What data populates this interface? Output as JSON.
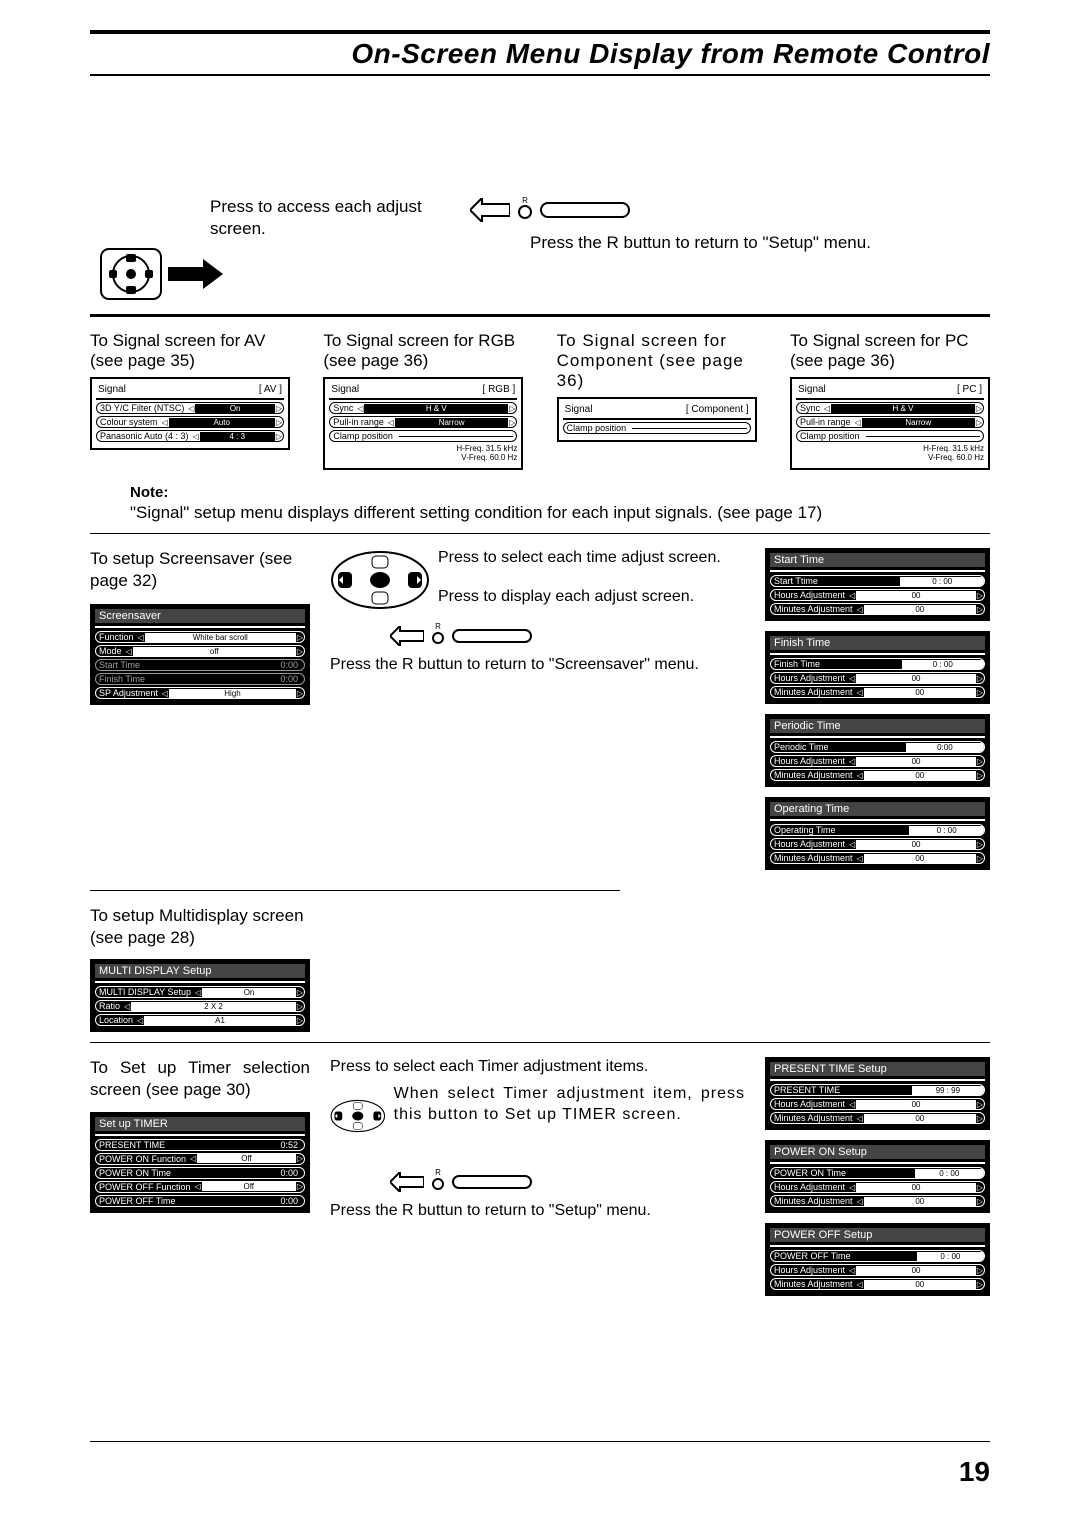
{
  "page_title": "On-Screen Menu Display from Remote Control",
  "page_number": "19",
  "intro": {
    "left_instr": "Press to access each adjust screen.",
    "right_instr": "Press the R buttun to return to \"Setup\" menu.",
    "r_label": "R"
  },
  "signals": {
    "av": {
      "heading": "To Signal screen for AV  (see page 35)",
      "title": "Signal",
      "tag": "[ AV ]",
      "rows": [
        {
          "label": "3D Y/C Filter (NTSC)",
          "val": "On"
        },
        {
          "label": "Colour system",
          "val": "Auto"
        },
        {
          "label": "Panasonic Auto (4 : 3)",
          "val": "4 : 3"
        }
      ]
    },
    "rgb": {
      "heading": "To Signal screen for RGB  (see page 36)",
      "title": "Signal",
      "tag": "[ RGB ]",
      "rows": [
        {
          "label": "Sync",
          "val": "H & V"
        },
        {
          "label": "Pull-in range",
          "val": "Narrow"
        },
        {
          "label": "Clamp position",
          "val": ""
        }
      ],
      "freq": [
        "H-Freq.  31.5  kHz",
        "V-Freq.  60.0  Hz"
      ]
    },
    "component": {
      "heading": "To Signal screen for Component (see page 36)",
      "title": "Signal",
      "tag": "[ Component ]",
      "rows": [
        {
          "label": "Clamp position",
          "val": ""
        }
      ]
    },
    "pc": {
      "heading": "To Signal screen for PC  (see page 36)",
      "title": "Signal",
      "tag": "[ PC ]",
      "rows": [
        {
          "label": "Sync",
          "val": "H & V"
        },
        {
          "label": "Pull-in range",
          "val": "Narrow"
        },
        {
          "label": "Clamp position",
          "val": ""
        }
      ],
      "freq": [
        "H-Freq.  31.5  kHz",
        "V-Freq.  60.0  Hz"
      ]
    }
  },
  "note": {
    "label": "Note:",
    "body": "\"Signal\" setup menu displays different setting condition for each input signals. (see page 17)"
  },
  "screensaver": {
    "heading": "To setup Screensaver  (see page 32)",
    "title": "Screensaver",
    "rows": [
      {
        "label": "Function",
        "val": "White bar scroll"
      },
      {
        "label": "Mode",
        "val": "off"
      },
      {
        "label": "Start Time",
        "val": "0:00",
        "dim": true
      },
      {
        "label": "Finish Time",
        "val": "0:00",
        "dim": true
      },
      {
        "label": "SP Adjustment",
        "val": "High"
      }
    ],
    "mid": {
      "a": "Press to select each time adjust screen.",
      "b": "Press to display each adjust screen.",
      "c": "Press the R buttun to return to \"Screensaver\" menu.",
      "r": "R"
    }
  },
  "time_panels": [
    {
      "gray": "Start Time",
      "rows": [
        {
          "label": "Start Ttime",
          "val": "0 : 00"
        },
        {
          "label": "Hours Adjustment",
          "val": "00"
        },
        {
          "label": "Minutes Adjustment",
          "val": "00"
        }
      ]
    },
    {
      "gray": "Finish Time",
      "rows": [
        {
          "label": "Finish Time",
          "val": "0 : 00"
        },
        {
          "label": "Hours Adjustment",
          "val": "00"
        },
        {
          "label": "Minutes Adjustment",
          "val": "00"
        }
      ]
    },
    {
      "gray": "Periodic Time",
      "rows": [
        {
          "label": "Periodic Time",
          "val": "0:00"
        },
        {
          "label": "Hours Adjustment",
          "val": "00"
        },
        {
          "label": "Minutes Adjustment",
          "val": "00"
        }
      ]
    },
    {
      "gray": "Operating Time",
      "rows": [
        {
          "label": "Operating Time",
          "val": "0 : 00"
        },
        {
          "label": "Hours Adjustment",
          "val": "00"
        },
        {
          "label": "Minutes Adjustment",
          "val": "00"
        }
      ]
    }
  ],
  "multidisplay": {
    "heading": "To setup Multidisplay screen (see page 28)",
    "title": "MULTI DISPLAY Setup",
    "rows": [
      {
        "label": "MULTI DISPLAY Setup",
        "val": "On"
      },
      {
        "label": "Ratio",
        "val": "2 X 2"
      },
      {
        "label": "Location",
        "val": "A1"
      }
    ]
  },
  "timer": {
    "heading": "To Set up Timer selection screen (see page 30)",
    "box_title": "Set up TIMER",
    "rows": [
      {
        "label": "PRESENT TIME",
        "val": "0:52"
      },
      {
        "label": "POWER ON Function",
        "val": "Off"
      },
      {
        "label": "POWER ON Time",
        "val": "0:00"
      },
      {
        "label": "POWER OFF Function",
        "val": "Off"
      },
      {
        "label": "POWER OFF Time",
        "val": "0:00"
      }
    ],
    "mid": {
      "a": "Press to select each Timer adjustment items.",
      "b": "When select Timer adjustment item, press this button to Set up TIMER screen.",
      "c": "Press the R buttun to return to \"Setup\" menu.",
      "r": "R"
    }
  },
  "timer_panels": [
    {
      "gray": "PRESENT TIME Setup",
      "rows": [
        {
          "label": "PRESENT TIME",
          "val": "99 : 99"
        },
        {
          "label": "Hours Adjustment",
          "val": "00"
        },
        {
          "label": "Minutes Adjustment",
          "val": "00"
        }
      ]
    },
    {
      "gray": "POWER ON Setup",
      "rows": [
        {
          "label": "POWER ON Time",
          "val": "0 : 00"
        },
        {
          "label": "Hours Adjustment",
          "val": "00"
        },
        {
          "label": "Minutes Adjustment",
          "val": "00"
        }
      ]
    },
    {
      "gray": "POWER OFF Setup",
      "rows": [
        {
          "label": "POWER OFF Time",
          "val": "0 : 00"
        },
        {
          "label": "Hours Adjustment",
          "val": "00"
        },
        {
          "label": "Minutes Adjustment",
          "val": "00"
        }
      ]
    }
  ]
}
